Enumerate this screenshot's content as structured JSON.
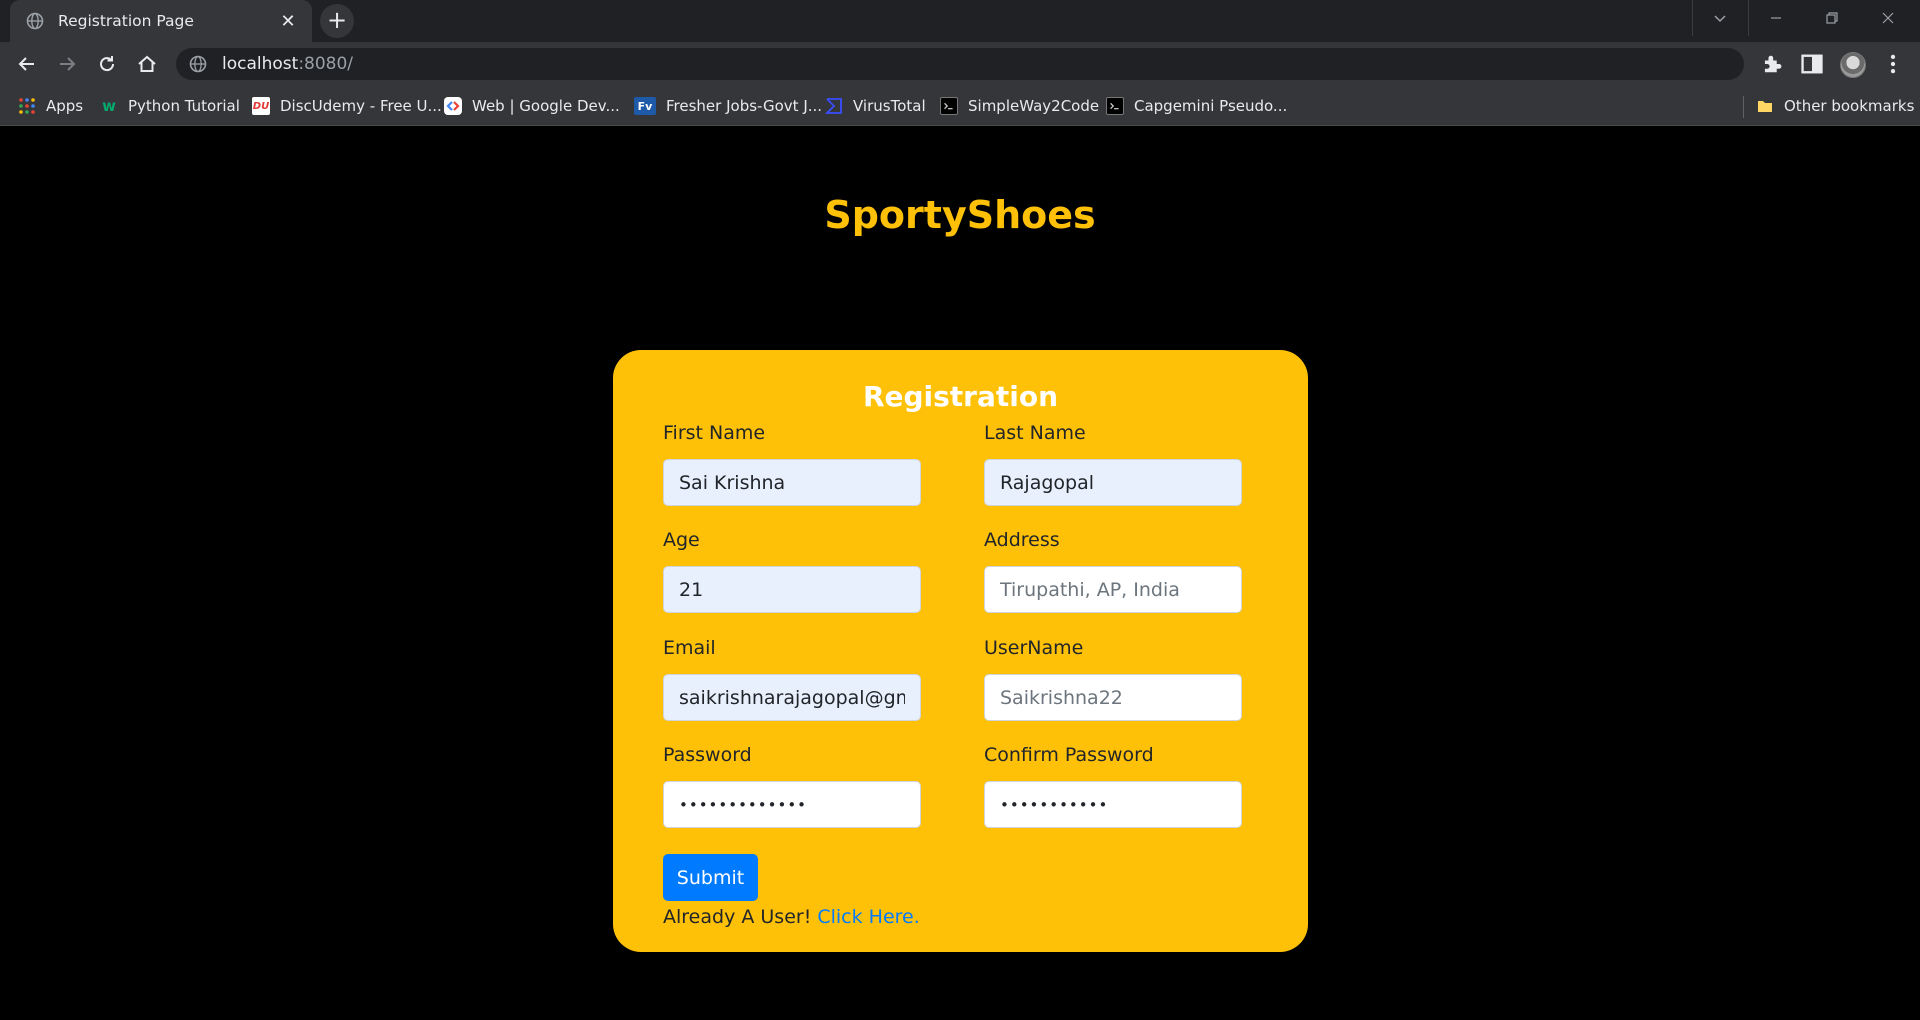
{
  "browser": {
    "tab_title": "Registration Page",
    "tab_close": "✕",
    "new_tab": "+",
    "url_host": "localhost",
    "url_rest": ":8080/",
    "bookmarks": [
      {
        "label": "Apps",
        "icon": "apps-grid-icon"
      },
      {
        "label": "Python Tutorial",
        "icon": "w3-icon",
        "color": "#04aa6d"
      },
      {
        "label": "DiscUdemy - Free U...",
        "icon": "discudemy-icon",
        "color": "#e53935"
      },
      {
        "label": "Web  |  Google Dev...",
        "icon": "google-dev-icon"
      },
      {
        "label": "Fresher Jobs-Govt J...",
        "icon": "fv-icon",
        "color": "#1e5aa8"
      },
      {
        "label": "VirusTotal",
        "icon": "virustotal-icon",
        "color": "#394eff"
      },
      {
        "label": "SimpleWay2Code",
        "icon": "terminal-icon"
      },
      {
        "label": "Capgemini Pseudo...",
        "icon": "terminal-icon"
      }
    ],
    "other_bookmarks": "Other bookmarks"
  },
  "page": {
    "brand": "SportyShoes",
    "form": {
      "title": "Registration",
      "first_name": {
        "label": "First Name",
        "value": "Sai Krishna"
      },
      "last_name": {
        "label": "Last Name",
        "value": "Rajagopal"
      },
      "age": {
        "label": "Age",
        "value": "21"
      },
      "address": {
        "label": "Address",
        "placeholder": "Tirupathi, AP, India"
      },
      "email": {
        "label": "Email",
        "value": "saikrishnarajagopal@gma"
      },
      "username": {
        "label": "UserName",
        "placeholder": "Saikrishna22"
      },
      "password": {
        "label": "Password",
        "value": "•••••••••••••"
      },
      "confirm_password": {
        "label": "Confirm Password",
        "value": "•••••••••••"
      },
      "submit_label": "Submit",
      "already_text": "Already A User! ",
      "login_link": "Click Here."
    }
  },
  "colors": {
    "accent": "#ffc107",
    "button": "#007bff",
    "link": "#007bff"
  }
}
